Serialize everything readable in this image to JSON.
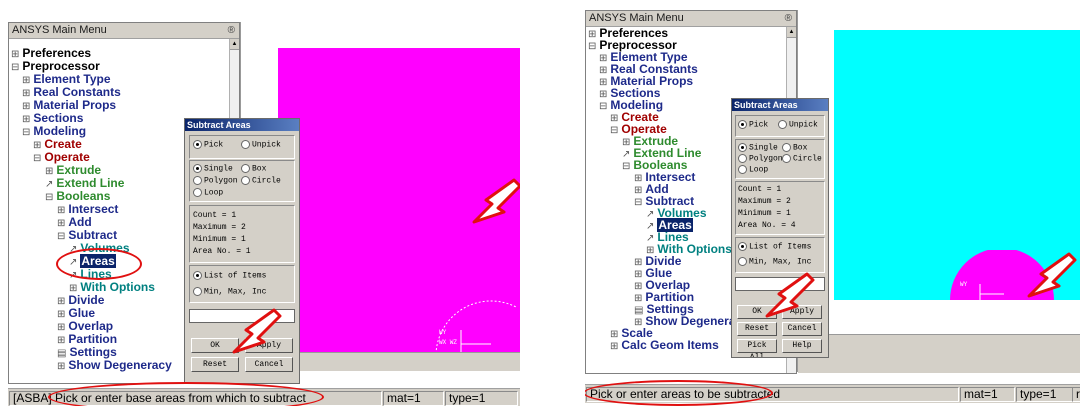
{
  "colors": {
    "accent_red": "#e01010",
    "magenta_area": "#ff00ff",
    "cyan_area": "#00ffff",
    "selection": "#0a246a"
  },
  "left": {
    "menu_title": "ANSYS Main Menu",
    "menu_pin": "®",
    "tree": [
      {
        "label": "Preferences",
        "glyph": "⊞"
      },
      {
        "label": "Preprocessor",
        "glyph": "⊟"
      },
      {
        "label": "Element Type",
        "glyph": "⊞"
      },
      {
        "label": "Real Constants",
        "glyph": "⊞"
      },
      {
        "label": "Material Props",
        "glyph": "⊞"
      },
      {
        "label": "Sections",
        "glyph": "⊞"
      },
      {
        "label": "Modeling",
        "glyph": "⊟"
      },
      {
        "label": "Create",
        "glyph": "⊞"
      },
      {
        "label": "Operate",
        "glyph": "⊟"
      },
      {
        "label": "Extrude",
        "glyph": "⊞"
      },
      {
        "label": "Extend Line",
        "glyph": "↗"
      },
      {
        "label": "Booleans",
        "glyph": "⊟"
      },
      {
        "label": "Intersect",
        "glyph": "⊞"
      },
      {
        "label": "Add",
        "glyph": "⊞"
      },
      {
        "label": "Subtract",
        "glyph": "⊟"
      },
      {
        "label": "Volumes",
        "glyph": "↗"
      },
      {
        "label": "Areas",
        "glyph": "↗"
      },
      {
        "label": "Lines",
        "glyph": "↗"
      },
      {
        "label": "With Options",
        "glyph": "⊞"
      },
      {
        "label": "Divide",
        "glyph": "⊞"
      },
      {
        "label": "Glue",
        "glyph": "⊞"
      },
      {
        "label": "Overlap",
        "glyph": "⊞"
      },
      {
        "label": "Partition",
        "glyph": "⊞"
      },
      {
        "label": "Settings",
        "glyph": "▤"
      },
      {
        "label": "Show Degeneracy",
        "glyph": "⊞"
      }
    ],
    "dialog": {
      "title": "Subtract Areas",
      "pick": "Pick",
      "unpick": "Unpick",
      "single": "Single",
      "box": "Box",
      "polygon": "Polygon",
      "circle": "Circle",
      "loop": "Loop",
      "count": "Count    =  1",
      "maximum": "Maximum  =  2",
      "minimum": "Minimum  =  1",
      "area_no": "Area No. =  1",
      "list_items": "List of Items",
      "min_max_inc": "Min, Max, Inc",
      "ok": "OK",
      "apply": "Apply",
      "reset": "Reset",
      "cancel": "Cancel"
    },
    "status": {
      "prompt": "[ASBA] Pick or enter base areas from which to subtract",
      "mat": "mat=1",
      "type": "type=1"
    }
  },
  "right": {
    "menu_title": "ANSYS Main Menu",
    "menu_pin": "®",
    "tree": [
      {
        "label": "Preferences",
        "glyph": "⊞"
      },
      {
        "label": "Preprocessor",
        "glyph": "⊟"
      },
      {
        "label": "Element Type",
        "glyph": "⊞"
      },
      {
        "label": "Real Constants",
        "glyph": "⊞"
      },
      {
        "label": "Material Props",
        "glyph": "⊞"
      },
      {
        "label": "Sections",
        "glyph": "⊞"
      },
      {
        "label": "Modeling",
        "glyph": "⊟"
      },
      {
        "label": "Create",
        "glyph": "⊞"
      },
      {
        "label": "Operate",
        "glyph": "⊟"
      },
      {
        "label": "Extrude",
        "glyph": "⊞"
      },
      {
        "label": "Extend Line",
        "glyph": "↗"
      },
      {
        "label": "Booleans",
        "glyph": "⊟"
      },
      {
        "label": "Intersect",
        "glyph": "⊞"
      },
      {
        "label": "Add",
        "glyph": "⊞"
      },
      {
        "label": "Subtract",
        "glyph": "⊟"
      },
      {
        "label": "Volumes",
        "glyph": "↗"
      },
      {
        "label": "Areas",
        "glyph": "↗"
      },
      {
        "label": "Lines",
        "glyph": "↗"
      },
      {
        "label": "With Options",
        "glyph": "⊞"
      },
      {
        "label": "Divide",
        "glyph": "⊞"
      },
      {
        "label": "Glue",
        "glyph": "⊞"
      },
      {
        "label": "Overlap",
        "glyph": "⊞"
      },
      {
        "label": "Partition",
        "glyph": "⊞"
      },
      {
        "label": "Settings",
        "glyph": "▤"
      },
      {
        "label": "Show Degenerac",
        "glyph": "⊞"
      },
      {
        "label": "Scale",
        "glyph": "⊞"
      },
      {
        "label": "Calc Geom Items",
        "glyph": "⊞"
      }
    ],
    "dialog": {
      "title": "Subtract Areas",
      "pick": "Pick",
      "unpick": "Unpick",
      "single": "Single",
      "box": "Box",
      "polygon": "Polygon",
      "circle": "Circle",
      "loop": "Loop",
      "count": "Count    =  1",
      "maximum": "Maximum  =  2",
      "minimum": "Minimum  =  1",
      "area_no": "Area No. =  4",
      "list_items": "List of Items",
      "min_max_inc": "Min, Max, Inc",
      "ok": "OK",
      "apply": "Apply",
      "reset": "Reset",
      "cancel": "Cancel",
      "pick_all": "Pick All",
      "help": "Help"
    },
    "status": {
      "prompt": "Pick or enter areas to be subtracted",
      "mat": "mat=1",
      "type": "type=1",
      "real": "rea"
    }
  }
}
